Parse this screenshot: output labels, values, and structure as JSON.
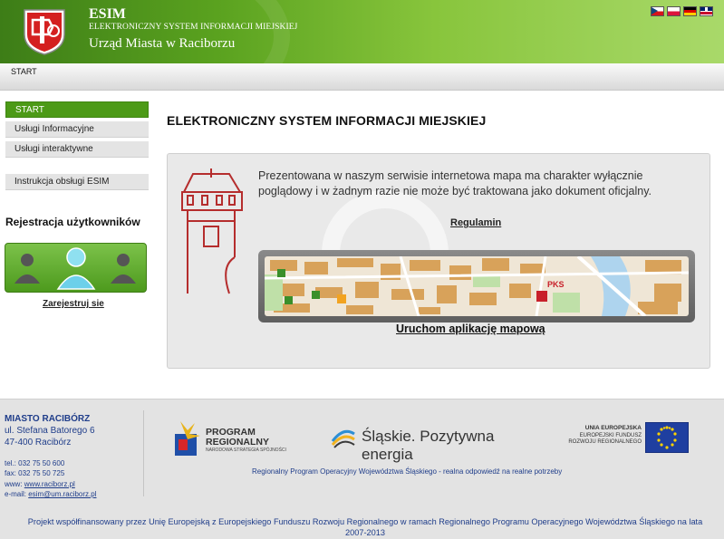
{
  "header": {
    "title": "ESIM",
    "subtitle": "ELEKTRONICZNY SYSTEM INFORMACJI MIEJSKIEJ",
    "city": "Urząd Miasta w Raciborzu",
    "languages": [
      "cz-flag-icon",
      "pl-flag-icon",
      "de-flag-icon",
      "gb-flag-icon"
    ]
  },
  "breadcrumb": {
    "current": "START"
  },
  "sidebar": {
    "items": [
      {
        "label": "START",
        "active": true
      },
      {
        "label": "Usługi Informacyjne"
      },
      {
        "label": "Usługi interaktywne"
      },
      {
        "label": "Instrukcja obsługi ESIM"
      }
    ],
    "registration_title": "Rejestracja użytkowników",
    "register_link": "Zarejestruj sie"
  },
  "main": {
    "title": "ELEKTRONICZNY SYSTEM INFORMACJI MIEJSKIEJ",
    "disclaimer": "Prezentowana w naszym serwisie internetowa mapa ma charakter wyłącznie poglądowy i w żadnym razie nie może być traktowana jako dokument oficjalny.",
    "regulations_link": "Regulamin",
    "map_label": "PKS",
    "launch_map_link": "Uruchom aplikację mapową"
  },
  "footer": {
    "city": "MIASTO RACIBÓRZ",
    "street": "ul. Stefana Batorego 6",
    "postal": "47-400 Racibórz",
    "tel": "tel.: 032 75 50 600",
    "fax": "fax: 032 75 50 725",
    "www_prefix": "www: ",
    "www": "www.raciborz.pl",
    "email_prefix": "e-mail: ",
    "email": "esim@um.raciborz.pl",
    "program_line1": "PROGRAM",
    "program_line2": "REGIONALNY",
    "program_sub": "NARODOWA STRATEGIA SPÓJNOŚCI",
    "slaskie": "Śląskie. Pozytywna energia",
    "eu_line1": "UNIA EUROPEJSKA",
    "eu_line2": "EUROPEJSKI FUNDUSZ",
    "eu_line3": "ROZWOJU REGIONALNEGO",
    "tagline": "Regionalny Program Operacyjny Województwa Śląskiego - realna odpowiedź na realne potrzeby",
    "project": "Projekt współfinansowany przez Unię Europejską z Europejskiego Funduszu Rozwoju Regionalnego w ramach Regionalnego Programu Operacyjnego Województwa Śląskiego na lata 2007-2013"
  },
  "colors": {
    "header_green": "#5aa21f",
    "active_nav": "#4c9a17",
    "footer_text": "#1f3d8a"
  }
}
